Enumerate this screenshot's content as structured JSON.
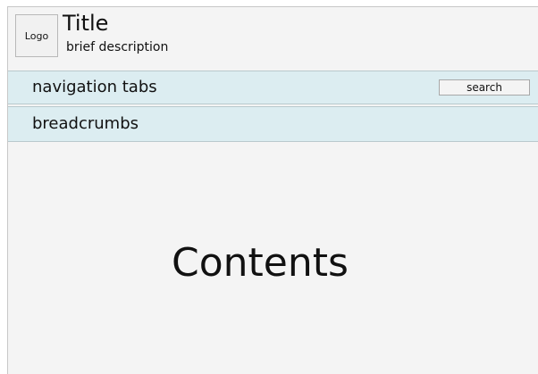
{
  "header": {
    "logo": "Logo",
    "title": "Title",
    "description": "brief description"
  },
  "navigation": {
    "label": "navigation tabs",
    "search": "search"
  },
  "breadcrumbs": {
    "label": "breadcrumbs"
  },
  "main": {
    "contents": "Contents"
  },
  "colors": {
    "page_background": "#f4f4f4",
    "bar_background": "#dcedf1",
    "border": "#b9c9cd"
  }
}
